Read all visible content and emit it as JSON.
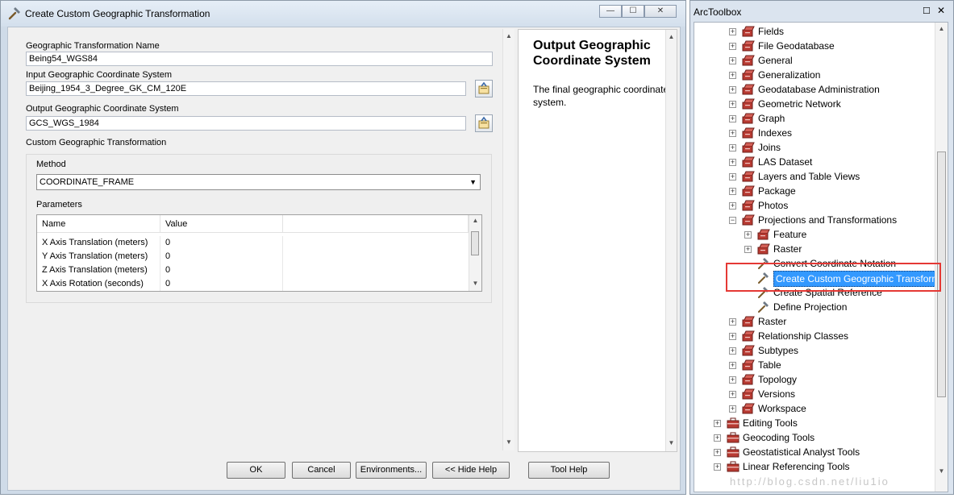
{
  "dialog": {
    "title": "Create Custom Geographic Transformation",
    "caption_buttons": {
      "minimize": "—",
      "maximize": "☐",
      "close": "✕"
    },
    "fields": {
      "name_label": "Geographic Transformation Name",
      "name_value": "Being54_WGS84",
      "input_gcs_label": "Input Geographic Coordinate System",
      "input_gcs_value": "Beijing_1954_3_Degree_GK_CM_120E",
      "output_gcs_label": "Output Geographic Coordinate System",
      "output_gcs_value": "GCS_WGS_1984",
      "custom_label": "Custom Geographic Transformation",
      "method_label": "Method",
      "method_value": "COORDINATE_FRAME",
      "parameters_label": "Parameters"
    },
    "table": {
      "headers": [
        "Name",
        "Value"
      ],
      "rows": [
        {
          "name": "X Axis Translation (meters)",
          "value": "0"
        },
        {
          "name": "Y Axis Translation (meters)",
          "value": "0"
        },
        {
          "name": "Z Axis Translation (meters)",
          "value": "0"
        },
        {
          "name": "X Axis Rotation (seconds)",
          "value": "0"
        }
      ]
    },
    "help": {
      "title": "Output Geographic Coordinate System",
      "text": "The final geographic coordinate system."
    },
    "buttons": {
      "ok": "OK",
      "cancel": "Cancel",
      "environments": "Environments...",
      "hide_help": "<< Hide Help",
      "tool_help": "Tool Help"
    }
  },
  "toolbox": {
    "title": "ArcToolbox",
    "caption_buttons": {
      "maximize": "☐",
      "close": "✕"
    },
    "items": [
      {
        "label": "Fields",
        "level": 1,
        "expander": "+",
        "icon": "toolset-icon"
      },
      {
        "label": "File Geodatabase",
        "level": 1,
        "expander": "+",
        "icon": "toolset-icon"
      },
      {
        "label": "General",
        "level": 1,
        "expander": "+",
        "icon": "toolset-icon"
      },
      {
        "label": "Generalization",
        "level": 1,
        "expander": "+",
        "icon": "toolset-icon"
      },
      {
        "label": "Geodatabase Administration",
        "level": 1,
        "expander": "+",
        "icon": "toolset-icon"
      },
      {
        "label": "Geometric Network",
        "level": 1,
        "expander": "+",
        "icon": "toolset-icon"
      },
      {
        "label": "Graph",
        "level": 1,
        "expander": "+",
        "icon": "toolset-icon"
      },
      {
        "label": "Indexes",
        "level": 1,
        "expander": "+",
        "icon": "toolset-icon"
      },
      {
        "label": "Joins",
        "level": 1,
        "expander": "+",
        "icon": "toolset-icon"
      },
      {
        "label": "LAS Dataset",
        "level": 1,
        "expander": "+",
        "icon": "toolset-icon"
      },
      {
        "label": "Layers and Table Views",
        "level": 1,
        "expander": "+",
        "icon": "toolset-icon"
      },
      {
        "label": "Package",
        "level": 1,
        "expander": "+",
        "icon": "toolset-icon"
      },
      {
        "label": "Photos",
        "level": 1,
        "expander": "+",
        "icon": "toolset-icon"
      },
      {
        "label": "Projections and Transformations",
        "level": 1,
        "expander": "−",
        "icon": "toolset-icon"
      },
      {
        "label": "Feature",
        "level": 2,
        "expander": "+",
        "icon": "toolset-icon"
      },
      {
        "label": "Raster",
        "level": 2,
        "expander": "+",
        "icon": "toolset-icon"
      },
      {
        "label": "Convert Coordinate Notation",
        "level": 2,
        "expander": "",
        "icon": "hammer-icon"
      },
      {
        "label": "Create Custom Geographic Transformation",
        "level": 2,
        "expander": "",
        "icon": "hammer-icon",
        "selected": true
      },
      {
        "label": "Create Spatial Reference",
        "level": 2,
        "expander": "",
        "icon": "hammer-icon"
      },
      {
        "label": "Define Projection",
        "level": 2,
        "expander": "",
        "icon": "hammer-icon"
      },
      {
        "label": "Raster",
        "level": 1,
        "expander": "+",
        "icon": "toolset-icon"
      },
      {
        "label": "Relationship Classes",
        "level": 1,
        "expander": "+",
        "icon": "toolset-icon"
      },
      {
        "label": "Subtypes",
        "level": 1,
        "expander": "+",
        "icon": "toolset-icon"
      },
      {
        "label": "Table",
        "level": 1,
        "expander": "+",
        "icon": "toolset-icon"
      },
      {
        "label": "Topology",
        "level": 1,
        "expander": "+",
        "icon": "toolset-icon"
      },
      {
        "label": "Versions",
        "level": 1,
        "expander": "+",
        "icon": "toolset-icon"
      },
      {
        "label": "Workspace",
        "level": 1,
        "expander": "+",
        "icon": "toolset-icon"
      },
      {
        "label": "Editing Tools",
        "level": 0,
        "expander": "+",
        "icon": "toolbox-icon"
      },
      {
        "label": "Geocoding Tools",
        "level": 0,
        "expander": "+",
        "icon": "toolbox-icon"
      },
      {
        "label": "Geostatistical Analyst Tools",
        "level": 0,
        "expander": "+",
        "icon": "toolbox-icon"
      },
      {
        "label": "Linear Referencing Tools",
        "level": 0,
        "expander": "+",
        "icon": "toolbox-icon"
      }
    ],
    "watermark": "http://blog.csdn.net/liu1io"
  },
  "colors": {
    "selection": "#3399ff",
    "highlight_box": "#e53935",
    "toolset_red": "#b83a32"
  }
}
